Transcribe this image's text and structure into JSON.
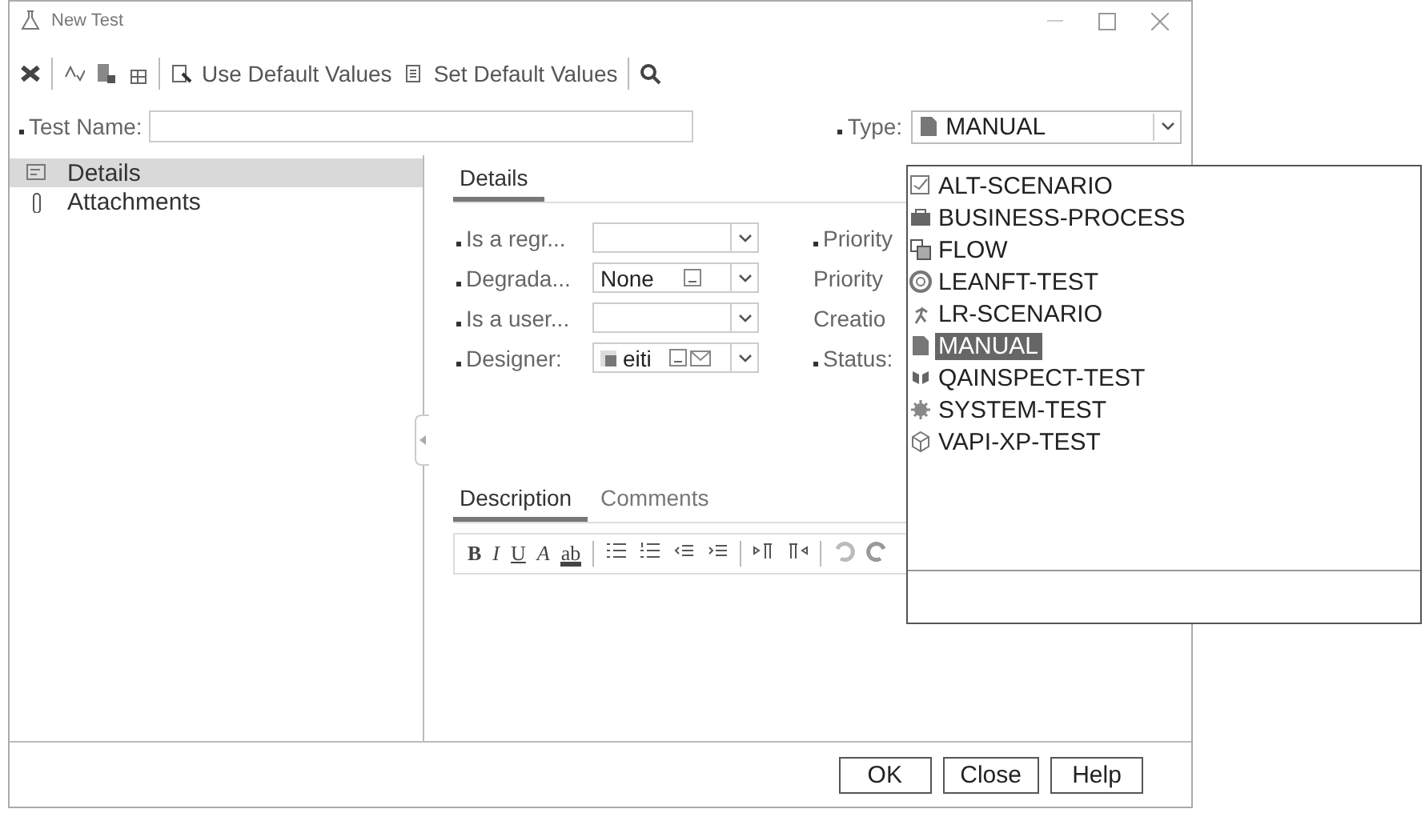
{
  "window": {
    "title": "New Test"
  },
  "toolbar": [
    {
      "kind": "icon"
    },
    {
      "kind": "separator"
    },
    {
      "kind": "icon"
    },
    {
      "kind": "icon"
    },
    {
      "kind": "icon"
    },
    {
      "kind": "separator"
    },
    {
      "kind": "button",
      "label": "Use Default Values"
    },
    {
      "kind": "button",
      "label": "Set Default Values"
    },
    {
      "kind": "separator"
    },
    {
      "kind": "icon"
    }
  ],
  "test_name": {
    "label": "Test Name:",
    "required": true
  },
  "type": {
    "label": "Type:",
    "required": true,
    "value": "MANUAL"
  },
  "sidebar": {
    "items": [
      {
        "label": "Details",
        "selected": true
      },
      {
        "label": "Attachments",
        "selected": false
      }
    ]
  },
  "details_tabs": [
    {
      "label": "Details",
      "selected": true
    }
  ],
  "left_fields": [
    {
      "label": "Is a regr...",
      "required": true,
      "kind": "combo"
    },
    {
      "label": "Degrada...",
      "required": true,
      "kind": "lookup",
      "value": "None"
    },
    {
      "label": "Is a user...",
      "required": true,
      "kind": "combo"
    },
    {
      "label": "Designer:",
      "required": true,
      "kind": "user",
      "value": "eiti"
    }
  ],
  "right_fields": [
    {
      "label": "Priority",
      "required": true
    },
    {
      "label": "Priority",
      "required": false
    },
    {
      "label": "Creatio",
      "required": false
    },
    {
      "label": "Status:",
      "required": true
    }
  ],
  "memo_tabs": [
    {
      "label": "Description",
      "selected": true
    },
    {
      "label": "Comments",
      "selected": false
    }
  ],
  "editor_toolbar": [
    {
      "kind": "bold",
      "label": "B"
    },
    {
      "kind": "italic",
      "label": "I"
    },
    {
      "kind": "underline",
      "label": "U"
    },
    {
      "kind": "italic",
      "label": "A"
    },
    {
      "kind": "highlight",
      "label": "ab"
    },
    {
      "kind": "separator"
    },
    {
      "kind": "icon"
    },
    {
      "kind": "icon"
    },
    {
      "kind": "icon"
    },
    {
      "kind": "icon"
    },
    {
      "kind": "separator"
    },
    {
      "kind": "icon"
    },
    {
      "kind": "icon"
    },
    {
      "kind": "separator"
    },
    {
      "kind": "icon"
    },
    {
      "kind": "icon"
    }
  ],
  "buttons": [
    "OK",
    "Close",
    "Help"
  ],
  "type_dropdown": {
    "options": [
      {
        "label": "ALT-SCENARIO",
        "selected": false
      },
      {
        "label": "BUSINESS-PROCESS",
        "selected": false
      },
      {
        "label": "FLOW",
        "selected": false
      },
      {
        "label": "LEANFT-TEST",
        "selected": false
      },
      {
        "label": "LR-SCENARIO",
        "selected": false
      },
      {
        "label": "MANUAL",
        "selected": true
      },
      {
        "label": "QAINSPECT-TEST",
        "selected": false
      },
      {
        "label": "SYSTEM-TEST",
        "selected": false
      },
      {
        "label": "VAPI-XP-TEST",
        "selected": false
      }
    ]
  }
}
